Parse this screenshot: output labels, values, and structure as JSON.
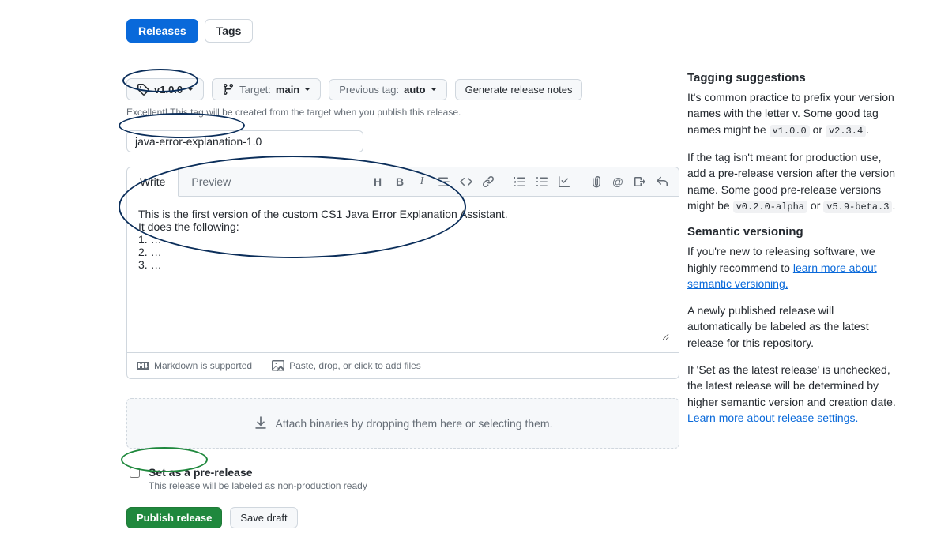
{
  "tabs": {
    "releases": "Releases",
    "tags": "Tags"
  },
  "tag_selector": {
    "value": "v1.0.0"
  },
  "target_selector": {
    "label": "Target:",
    "value": "main"
  },
  "prev_tag_selector": {
    "label": "Previous tag:",
    "value": "auto"
  },
  "generate_notes_btn": "Generate release notes",
  "tag_hint": "Excellent! This tag will be created from the target when you publish this release.",
  "title_input": {
    "value": "java-error-explanation-1.0"
  },
  "editor": {
    "tab_write": "Write",
    "tab_preview": "Preview",
    "body": "This is the first version of the custom CS1 Java Error Explanation Assistant.\nIt does the following:\n1. …\n2. …\n3. …",
    "footer_markdown": "Markdown is supported",
    "footer_upload": "Paste, drop, or click to add files"
  },
  "attach_zone": "Attach binaries by dropping them here or selecting them.",
  "prerelease": {
    "label": "Set as a pre-release",
    "sub": "This release will be labeled as non-production ready"
  },
  "actions": {
    "publish": "Publish release",
    "draft": "Save draft"
  },
  "sidebar": {
    "tagging_heading": "Tagging suggestions",
    "tagging_p1a": "It's common practice to prefix your version names with the letter v. Some good tag names might be ",
    "tagging_code1": "v1.0.0",
    "tagging_or": " or ",
    "tagging_code2": "v2.3.4",
    "period": ".",
    "tagging_p2a": "If the tag isn't meant for production use, add a pre-release version after the version name. Some good pre-release versions might be ",
    "tagging_code3": "v0.2.0-alpha",
    "tagging_code4": "v5.9-beta.3",
    "semver_heading": "Semantic versioning",
    "semver_p1": "If you're new to releasing software, we highly recommend to ",
    "semver_link": "learn more about semantic versioning.",
    "semver_p2": "A newly published release will automatically be labeled as the latest release for this repository.",
    "semver_p3": "If 'Set as the latest release' is unchecked, the latest release will be determined by higher semantic version and creation date. ",
    "settings_link": "Learn more about release settings."
  }
}
